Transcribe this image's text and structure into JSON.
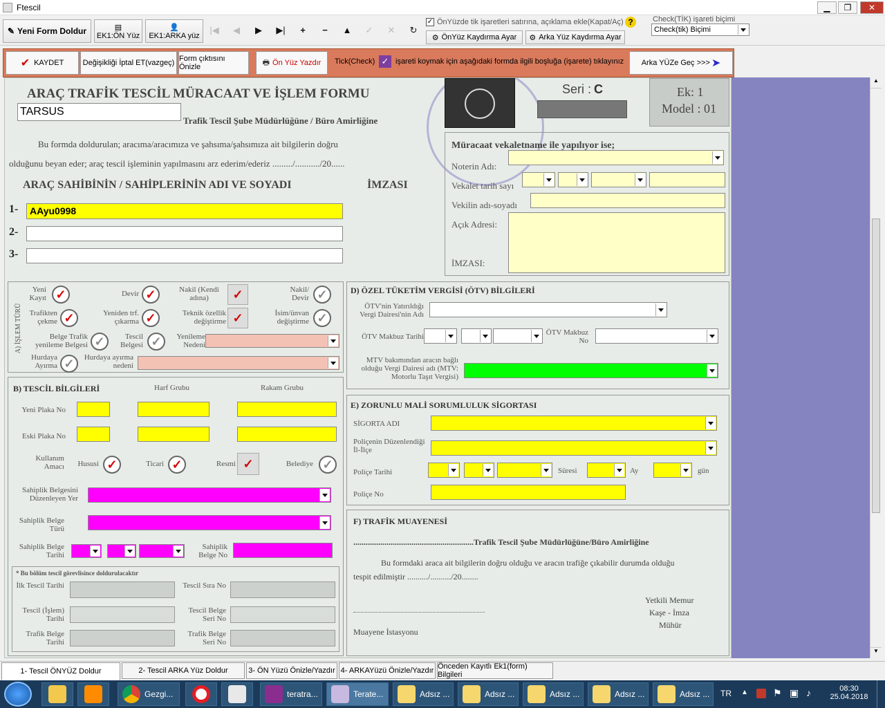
{
  "window": {
    "title": "Ftescil"
  },
  "toolbar": {
    "new_form": "Yeni Form Doldur",
    "ek1_front": "EK1:ÖN Yüz",
    "ek1_back": "EK1:ARKA yüz",
    "nav": [
      "|◀",
      "◀",
      "▶",
      "▶|",
      "+",
      "−",
      "▲",
      "✓",
      "✕",
      "↻"
    ],
    "checkbox_label": "ÖnYüzde tik işaretleri satırına, açıklama ekle(Kapat/Aç)",
    "help": "?",
    "front_shift": "ÖnYüz Kaydırma Ayar",
    "back_shift": "Arka Yüz Kaydırma Ayar",
    "check_format_label": "Check(TİK) işareti biçimi",
    "check_format_value": "Check(tik) Biçimi"
  },
  "actions": {
    "save": "KAYDET",
    "cancel": "Değişikliği İptal ET(vazgeç)",
    "preview": "Form çıktısını Önizle",
    "print_front": "Ön Yüz Yazdır",
    "tick_hint_a": "Tick(Check)",
    "tick_hint_b": "işareti koymak için aşağıdaki formda ilgili boşluğa (işarete) tıklayınız",
    "go_back": "Arka YÜZe Geç >>>"
  },
  "form": {
    "title": "ARAÇ TRAFİK TESCİL MÜRACAAT VE İŞLEM FORMU",
    "city": "TARSUS",
    "office": "Trafik Tescil Şube Müdürlüğüne / Büro Amirliğine",
    "declaration1": "Bu formda doldurulan; aracıma/aracımıza ve şahsıma/şahsımıza ait bilgilerin doğru",
    "declaration2": "olduğunu beyan eder; araç tescil işleminin yapılmasını arz ederim/ederiz ........./.........../20......",
    "owners_heading": "ARAÇ SAHİBİNİN / SAHİPLERİNİN ADI VE SOYADI",
    "signature_heading": "İMZASI",
    "owners": [
      {
        "num": "1-",
        "value": "AAyu0998"
      },
      {
        "num": "2-",
        "value": ""
      },
      {
        "num": "3-",
        "value": ""
      }
    ],
    "seri_label": "Seri :",
    "seri_value": "C",
    "ek_label": "Ek: 1",
    "model_label": "Model : 01",
    "proxy": {
      "heading": "Müracaat vekaletname ile yapılıyor ise;",
      "notary": "Noterin Adı:",
      "date": "Vekalet tarih sayı",
      "agent": "Vekilin adı-soyadı",
      "address": "Açık Adresi:",
      "signature": "İMZASI:"
    },
    "section_a": {
      "vertical": "A) İŞLEM TÜRÜ",
      "new_reg": "Yeni Kayıt",
      "transfer": "Devir",
      "transfer_own": "Nakil (Kendi adına)",
      "transfer_sale": "Nakil/ Devir",
      "out_traffic": "Trafikten çekme",
      "back_traffic": "Yeniden trf. çıkarma",
      "tech_change": "Teknik özellik değiştirme",
      "name_change": "İsim/ünvan değiştirme",
      "renew_doc": "Belge Trafik yenileme Belgesi",
      "reg_doc": "Tescil Belgesi",
      "renew_reason": "Yenileme Nedeni",
      "scrap": "Hurdaya Ayırma",
      "scrap_reason": "Hurdaya ayırma nedeni"
    },
    "section_b": {
      "heading": "B) TESCİL BİLGİLERİ",
      "letter_group": "Harf Grubu",
      "number_group": "Rakam Grubu",
      "new_plate": "Yeni Plaka No",
      "old_plate": "Eski Plaka No",
      "usage": "Kullanım Amacı",
      "private": "Hususi",
      "commercial": "Ticari",
      "official": "Resmi",
      "municipal": "Belediye",
      "doc_place": "Sahiplik Belgesini Düzenleyen Yer",
      "doc_type": "Sahiplik Belge Türü",
      "doc_date": "Sahiplik Belge Tarihi",
      "doc_no": "Sahiplik Belge No",
      "officer_note": "* Bu bölüm tescil görevlisince doldurulacaktır",
      "first_reg": "İlk Tescil Tarihi",
      "reg_seq": "Tescil Sıra No",
      "reg_date": "Tescil (İşlem) Tarihi",
      "reg_serial": "Tescil Belge Seri No",
      "traffic_date": "Trafik Belge Tarihi",
      "traffic_serial": "Trafik Belge Seri No"
    },
    "section_d": {
      "heading": "D) ÖZEL TÜKETİM VERGİSİ (ÖTV) BİLGİLERİ",
      "tax_office": "ÖTV'nin Yatırıldığı Vergi Dairesi'nin Adı",
      "receipt_date": "ÖTV Makbuz Tarihi",
      "receipt_no": "ÖTV Makbuz No",
      "mtv": "MTV bakımından aracın bağlı olduğu Vergi Dairesi adı (MTV: Motorlu Taşıt Vergisi)"
    },
    "section_e": {
      "heading": "E) ZORUNLU MALİ SORUMLULUK SİGORTASI",
      "insurer": "SİGORTA ADI",
      "policy_city": "Poliçenin Düzenlendiği İl-İlçe",
      "policy_date": "Poliçe Tarihi",
      "duration": "Süresi",
      "month": "Ay",
      "day": "gün",
      "policy_no": "Poliçe No"
    },
    "section_f": {
      "heading": "F) TRAFİK MUAYENESİ",
      "office": "..........................................................Trafik Tescil Şube Müdürlüğüne/Büro Amirliğine",
      "text1": "Bu formdaki araca ait bilgilerin doğru olduğu ve aracın trafiğe çıkabilir durumda olduğu",
      "text2": "tespit edilmiştir ........../........../20........",
      "official": "Yetkili Memur",
      "stamp": "Kaşe - İmza",
      "seal": "Mühür",
      "station": "Muayene İstasyonu"
    }
  },
  "tabs": [
    "1- Tescil ÖNYÜZ Doldur",
    "2- Tescil ARKA Yüz Doldur",
    "3- ÖN Yüzü Önizle/Yazdır",
    "4- ARKAYüzü Önizle/Yazdır",
    "Önceden Kayıtlı Ek1(form) Bilgileri"
  ],
  "taskbar": {
    "items": [
      "",
      "",
      "",
      "Gezgi...",
      "",
      "",
      "teratra...",
      "Terate...",
      "Adsız ...",
      "Adsız ...",
      "Adsız ...",
      "Adsız ...",
      "Adsız ..."
    ],
    "lang": "TR",
    "time": "08:30",
    "date": "25.04.2018"
  },
  "colors": {
    "accent_bar": "#d97a5c",
    "purple_panel": "#8583c0",
    "taskbar": "#1b3a5a"
  }
}
